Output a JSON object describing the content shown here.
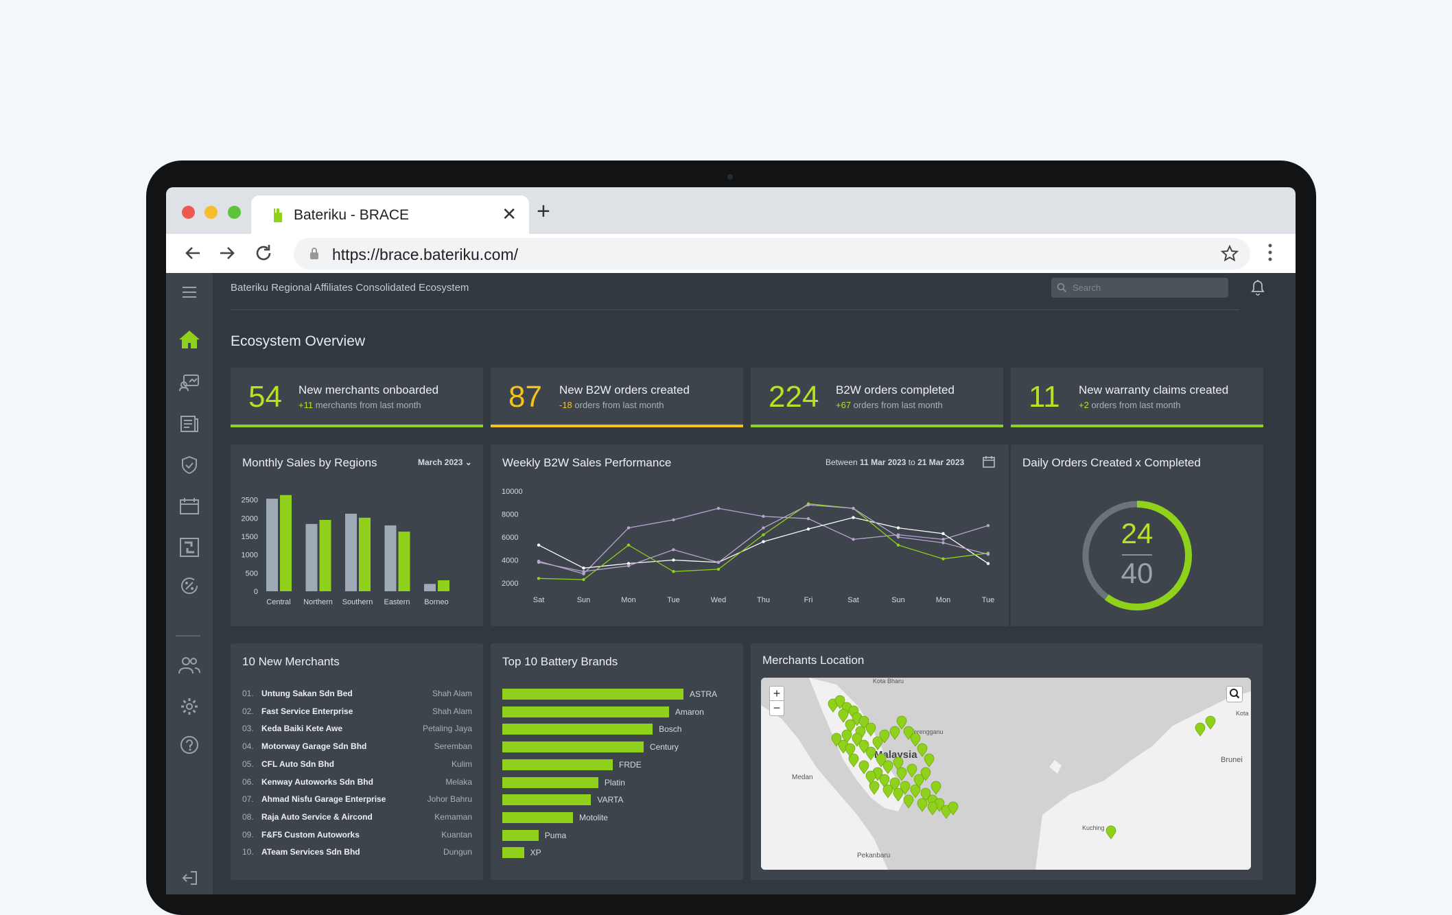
{
  "browser": {
    "tab_title": "Bateriku - BRACE",
    "url": "https://brace.bateriku.com/"
  },
  "colors": {
    "accent": "#8fd11b",
    "warning": "#f2c318",
    "background": "#32383f",
    "card": "#3d444b"
  },
  "header": {
    "app_title": "Bateriku Regional Affiliates Consolidated Ecosystem",
    "search_placeholder": "Search"
  },
  "sidebar": {
    "items": [
      "home-icon",
      "merchants-icon",
      "documents-icon",
      "warranty-icon",
      "calendar-icon",
      "exchange-icon",
      "promotion-icon",
      "users-icon",
      "settings-icon",
      "help-icon",
      "logout-icon"
    ]
  },
  "page_title": "Ecosystem Overview",
  "kpis": [
    {
      "value": "54",
      "title": "New merchants onboarded",
      "delta": "+11",
      "sub": " merchants from last month"
    },
    {
      "value": "87",
      "title": "New B2W orders created",
      "delta": "-18",
      "sub": " orders from last month"
    },
    {
      "value": "224",
      "title": "B2W orders completed",
      "delta": "+67",
      "sub": " orders from last month"
    },
    {
      "value": "11",
      "title": "New warranty claims created",
      "delta": "+2",
      "sub": " orders from last month"
    }
  ],
  "monthly": {
    "title": "Monthly Sales by Regions",
    "period": "March 2023"
  },
  "weekly": {
    "title": "Weekly B2W Sales Performance",
    "range_prefix": "Between ",
    "range_from": "11 Mar 2023",
    "range_mid": " to ",
    "range_to": "21 Mar 2023"
  },
  "daily": {
    "title": "Daily Orders Created x Completed",
    "completed": "24",
    "created": "40"
  },
  "chart_data": [
    {
      "type": "bar",
      "title": "Monthly Sales by Regions",
      "categories": [
        "Central",
        "Northern",
        "Southern",
        "Eastern",
        "Borneo"
      ],
      "series": [
        {
          "values": [
            2530,
            1840,
            2120,
            1800,
            200
          ]
        },
        {
          "values": [
            2630,
            1950,
            2010,
            1630,
            300
          ]
        }
      ],
      "yticks": [
        0,
        500,
        1000,
        1500,
        2000,
        2500
      ],
      "ylim": [
        0,
        2700
      ]
    },
    {
      "type": "line",
      "title": "Weekly B2W Sales Performance",
      "categories": [
        "Sat",
        "Sun",
        "Mon",
        "Tue",
        "Wed",
        "Thu",
        "Fri",
        "Sat",
        "Sun",
        "Mon",
        "Tue"
      ],
      "series": [
        {
          "color": "#b9a5cf",
          "values": [
            3900,
            2800,
            6800,
            7500,
            8500,
            7800,
            7600,
            5800,
            6200,
            5800,
            7000
          ]
        },
        {
          "color": "#ffffff",
          "values": [
            5300,
            3300,
            3700,
            4000,
            3800,
            5600,
            6700,
            7700,
            6800,
            6300,
            3700
          ]
        },
        {
          "color": "#8fd11b",
          "values": [
            2400,
            2300,
            5300,
            3000,
            3200,
            6200,
            8900,
            8500,
            5300,
            4100,
            4600
          ]
        },
        {
          "color": "#b9a5cf",
          "values": [
            3800,
            3000,
            3500,
            4900,
            3800,
            6800,
            8800,
            8500,
            6000,
            5500,
            4500
          ]
        }
      ],
      "yticks": [
        2000,
        4000,
        6000,
        8000,
        10000
      ],
      "ylim": [
        2000,
        10000
      ]
    },
    {
      "type": "pie",
      "title": "Daily Orders Created x Completed",
      "values": [
        24,
        40
      ]
    }
  ],
  "merchants": {
    "title": "10 New Merchants",
    "rows": [
      {
        "n": "01.",
        "name": "Untung Sakan Sdn Bed",
        "loc": "Shah Alam"
      },
      {
        "n": "02.",
        "name": "Fast Service Enterprise",
        "loc": "Shah Alam"
      },
      {
        "n": "03.",
        "name": "Keda Baiki Kete Awe",
        "loc": "Petaling Jaya"
      },
      {
        "n": "04.",
        "name": "Motorway Garage Sdn Bhd",
        "loc": "Seremban"
      },
      {
        "n": "05.",
        "name": "CFL Auto Sdn Bhd",
        "loc": "Kulim"
      },
      {
        "n": "06.",
        "name": "Kenway Autoworks Sdn Bhd",
        "loc": "Melaka"
      },
      {
        "n": "07.",
        "name": "Ahmad Nisfu Garage Enterprise",
        "loc": "Johor Bahru"
      },
      {
        "n": "08.",
        "name": "Raja Auto Service & Aircond",
        "loc": "Kemaman"
      },
      {
        "n": "09.",
        "name": "F&F5 Custom Autoworks",
        "loc": "Kuantan"
      },
      {
        "n": "10.",
        "name": "ATeam Services Sdn Bhd",
        "loc": "Dungun"
      }
    ]
  },
  "brands": {
    "title": "Top 10 Battery Brands",
    "items": [
      {
        "name": "ASTRA",
        "value": 100
      },
      {
        "name": "Amaron",
        "value": 92
      },
      {
        "name": "Bosch",
        "value": 83
      },
      {
        "name": "Century",
        "value": 78
      },
      {
        "name": "FRDE",
        "value": 61
      },
      {
        "name": "Platin",
        "value": 53
      },
      {
        "name": "VARTA",
        "value": 49
      },
      {
        "name": "Motolite",
        "value": 39
      },
      {
        "name": "Puma",
        "value": 20
      },
      {
        "name": "XP",
        "value": 12
      }
    ]
  },
  "map": {
    "title": "Merchants Location",
    "labels": [
      "Malaysia",
      "Medan",
      "Pekanbaru",
      "Brunei",
      "Kota Bharu",
      "Terengganu",
      "Kuching",
      "Kota"
    ]
  }
}
